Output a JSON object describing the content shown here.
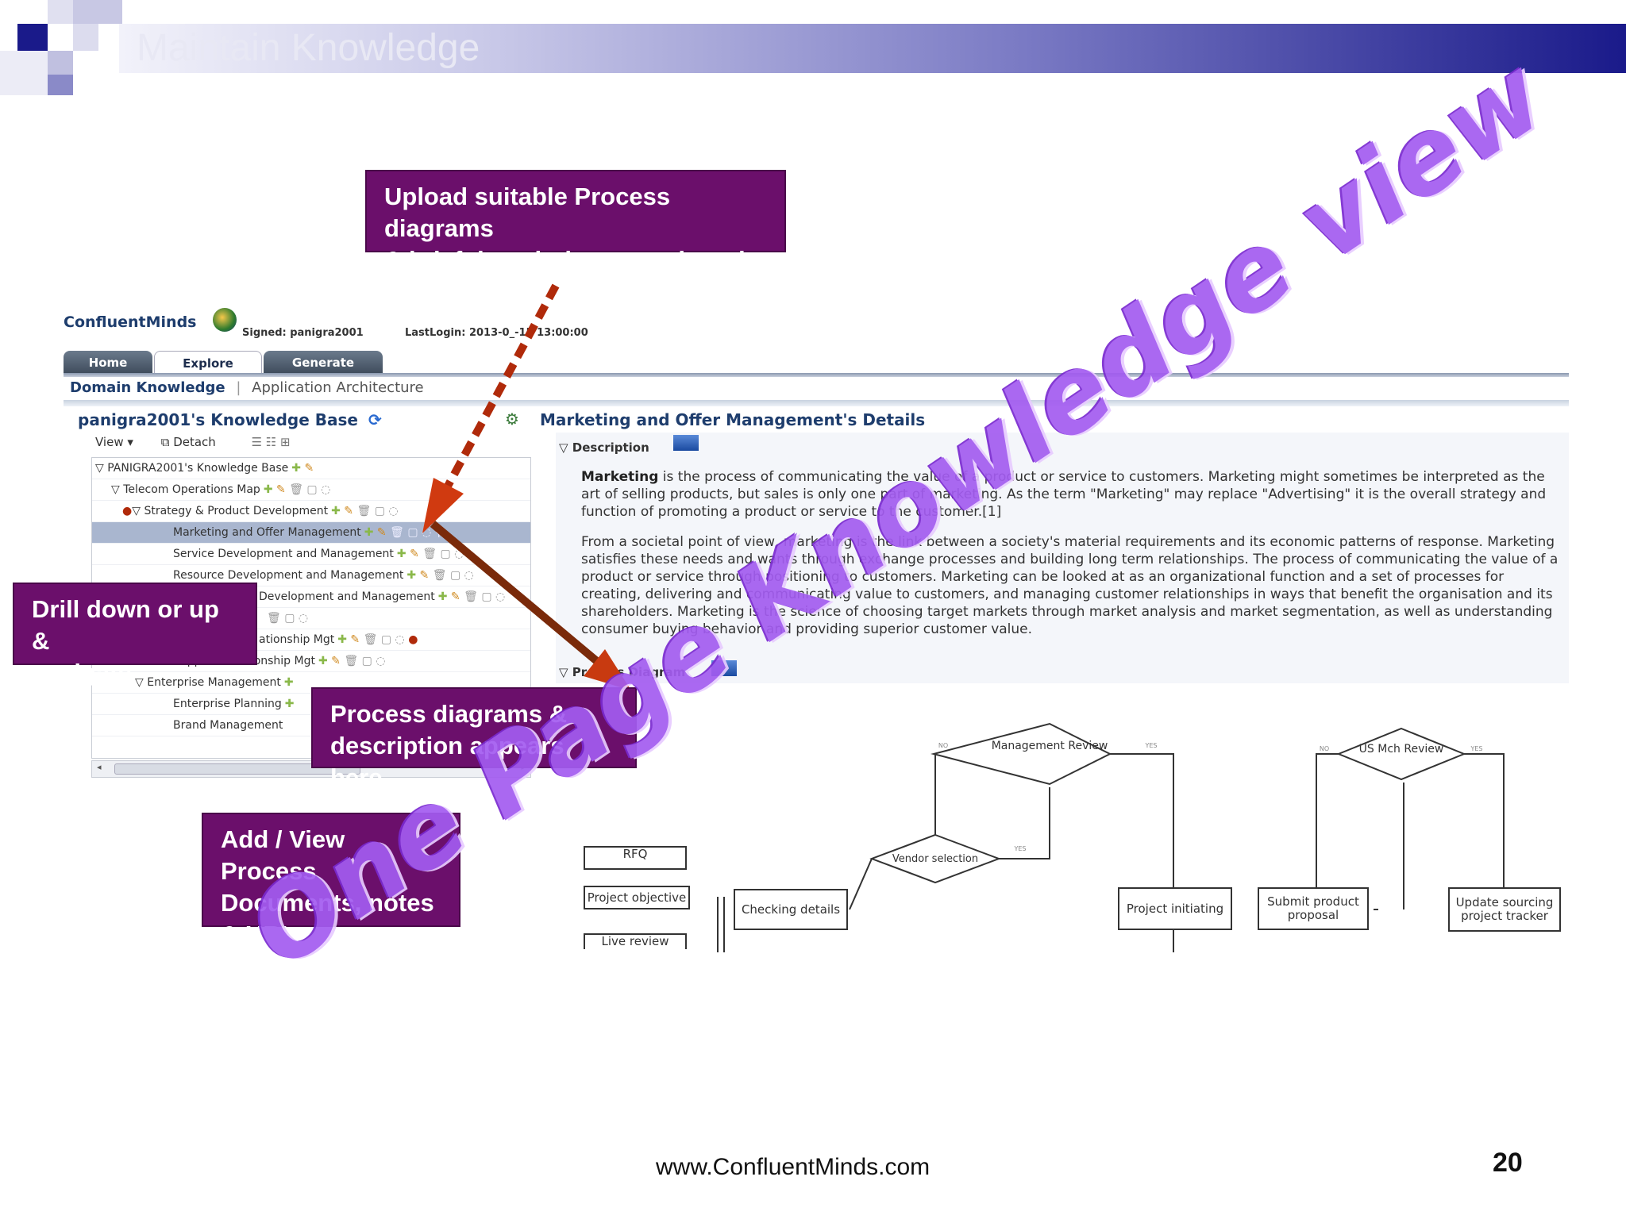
{
  "slide": {
    "title": "Maintain Knowledge",
    "footer_url": "www.ConfluentMinds.com",
    "page_number": "20",
    "watermark": "One Page Knowledge view"
  },
  "callouts": {
    "upload": [
      "Upload suitable Process diagrams",
      "& brief description at each node"
    ],
    "drill": [
      "Drill down or up &",
      "navigate"
    ],
    "process": [
      "Process diagrams &",
      "description appears here"
    ],
    "add_view": [
      "Add / View Process",
      "Documents, notes",
      "& URLs"
    ]
  },
  "app": {
    "brand": "ConfluentMinds",
    "signed": "Signed: panigra2001",
    "lastlogin": "LastLogin: 2013-0_-15 13:00:00",
    "tabs": [
      "Home",
      "Explore",
      "Generate"
    ],
    "breadcrumb": {
      "active": "Domain Knowledge",
      "separator": "|",
      "other": "Application Architecture"
    },
    "left_title": "panigra2001's Knowledge Base",
    "toolbar": {
      "view": "View",
      "detach": "Detach"
    },
    "tree": [
      {
        "label": "PANIGRA2001's Knowledge Base",
        "indent": 0
      },
      {
        "label": "Telecom Operations Map",
        "indent": 1
      },
      {
        "label": "Strategy & Product Development",
        "indent": 2
      },
      {
        "label": "Marketing and Offer Management",
        "indent": 3
      },
      {
        "label": "Service Development and Management",
        "indent": 3
      },
      {
        "label": "Resource Development and Management",
        "indent": 3
      },
      {
        "label": "Development and Management",
        "indent": 3
      },
      {
        "label": "",
        "indent": 3
      },
      {
        "label": "ationship Mgt",
        "indent": 3
      },
      {
        "label": "Supplier Relationship Mgt",
        "indent": 3
      },
      {
        "label": "Enterprise Management",
        "indent": 2
      },
      {
        "label": "Enterprise Planning",
        "indent": 3
      },
      {
        "label": "Brand Management",
        "indent": 3
      }
    ],
    "right_title": "Marketing and Offer Management's Details",
    "description_label": "Description",
    "diagram_label": "Process Diagram",
    "desc_p1": {
      "lead": "Marketing",
      "text": " is the process of communicating the value of a product or service to customers. Marketing might sometimes be interpreted as the art of selling products, but sales is only one part of marketing. As the term \"Marketing\" may replace \"Advertising\" it is the overall strategy and function of promoting a product or service to the customer.[1]"
    },
    "desc_p2": "From a societal point of view, marketing is the link between a society's material requirements and its economic patterns of response. Marketing satisfies these needs and wants through exchange processes and building long term relationships. The process of communicating the value of a product or service through positioning to customers. Marketing can be looked at as an organizational function and a set of processes for creating, delivering and communicating value to customers, and managing customer relationships in ways that benefit the organisation and its shareholders. Marketing is the science of choosing target markets through market analysis and market segmentation, as well as understanding consumer buying behavior and providing superior customer value."
  },
  "flowchart": {
    "nodes": {
      "mgmt_review": "Management Review",
      "us_mch_review": "US Mch Review",
      "rfq": "RFQ",
      "project_objective": "Project objective",
      "live_review": "Live review",
      "checking_details": "Checking details",
      "vendor_selection": "Vendor selection",
      "project_initiating": "Project initiating",
      "submit_product_proposal": "Submit product proposal",
      "update_sourcing": "Update sourcing project tracker"
    },
    "edge_labels": {
      "no": "NO",
      "yes": "YES"
    }
  },
  "colors": {
    "callout_bg": "#6b0f6b",
    "arrow": "#b02a0a",
    "watermark": "#a35cf0",
    "title_bar_end": "#1a1a8a"
  },
  "icons": [
    "add-icon",
    "edit-icon",
    "delete-icon",
    "note-icon",
    "link-icon",
    "refresh-icon",
    "help-icon",
    "detach-icon"
  ]
}
